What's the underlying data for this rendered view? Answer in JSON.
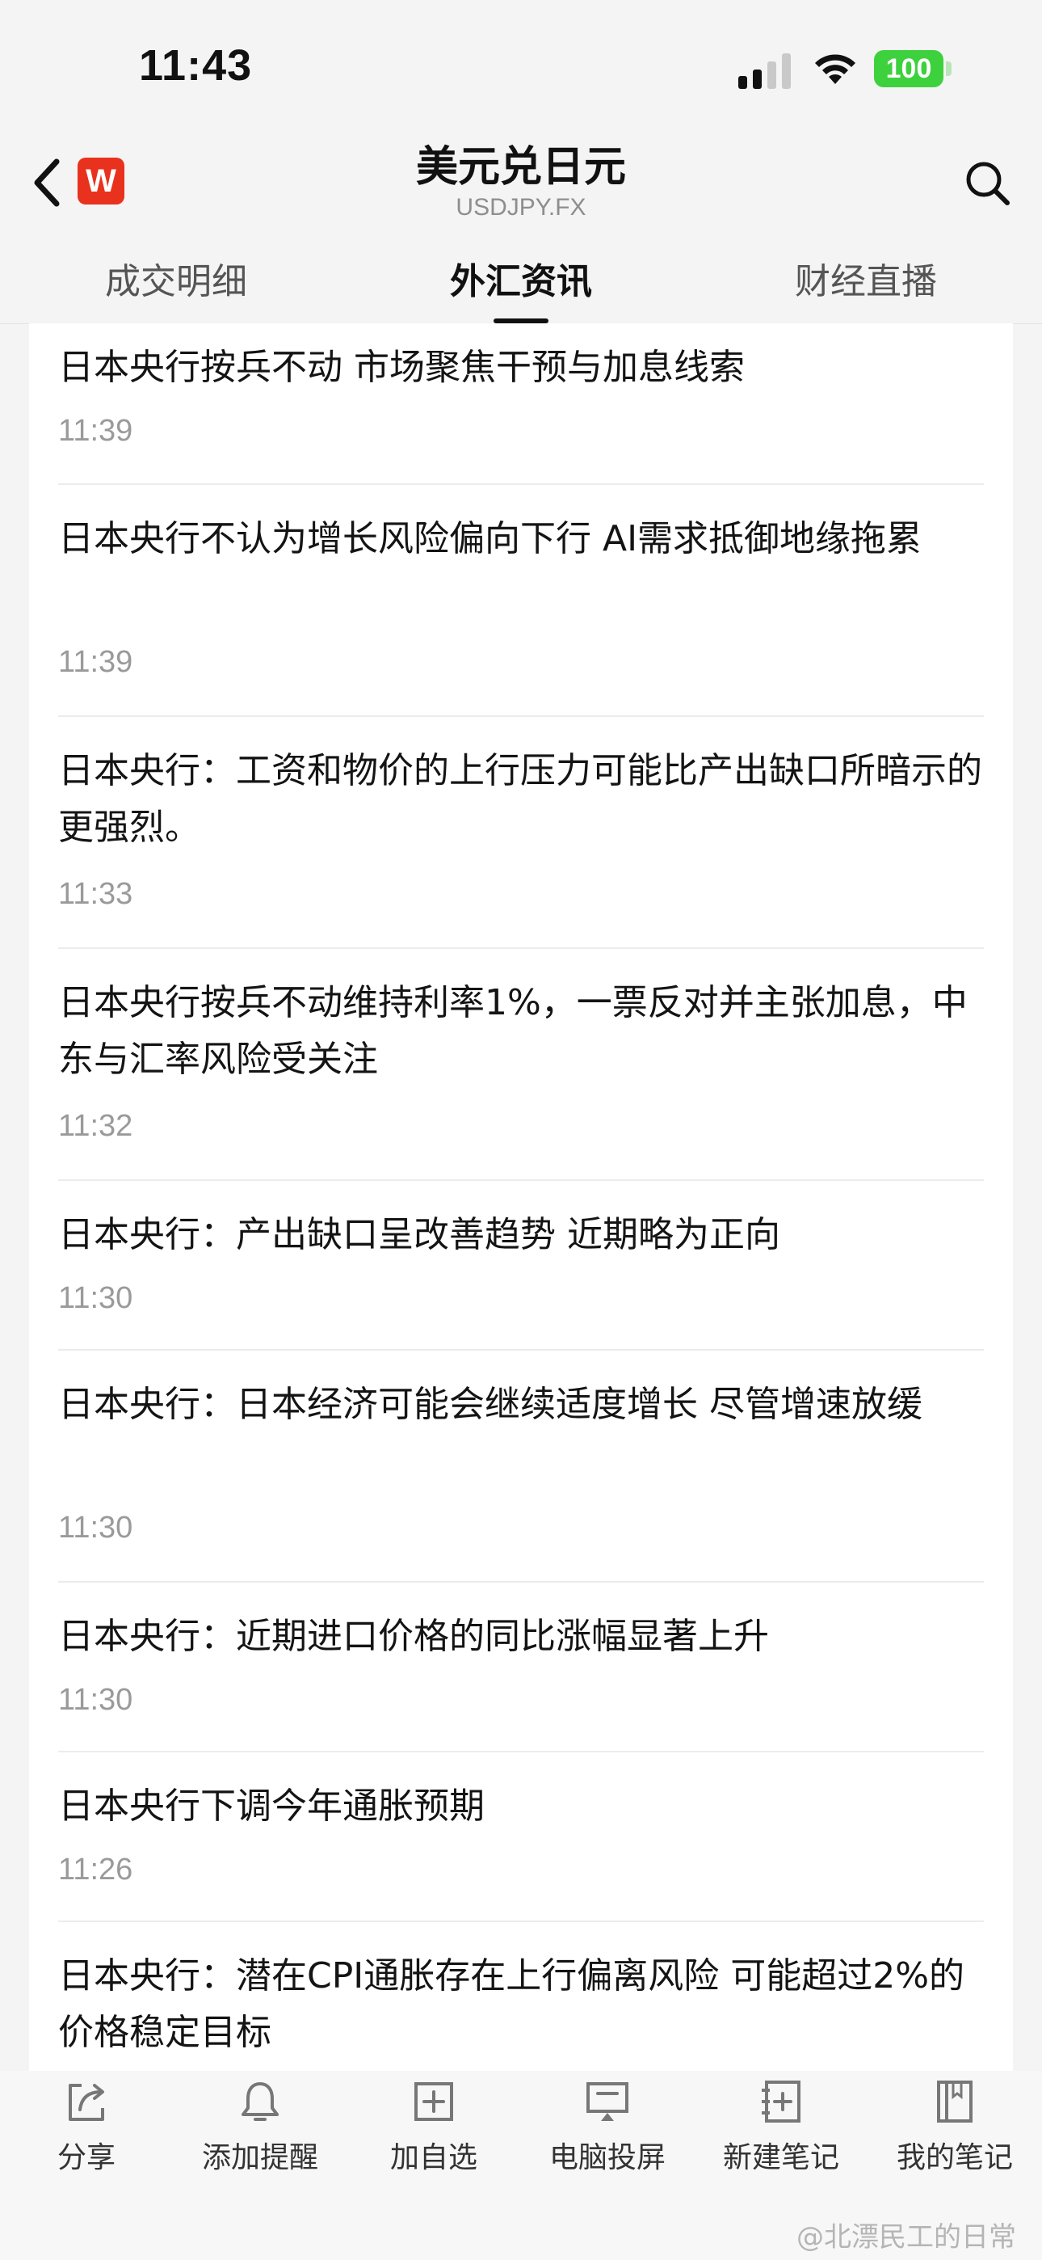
{
  "status_bar": {
    "time": "11:43",
    "battery": "100"
  },
  "header": {
    "title": "美元兑日元",
    "subtitle": "USDJPY.FX",
    "logo_letter": "W"
  },
  "tabs": [
    {
      "label": "成交明细"
    },
    {
      "label": "外汇资讯"
    },
    {
      "label": "财经直播"
    }
  ],
  "news": [
    {
      "title": "日本央行按兵不动 市场聚焦干预与加息线索",
      "time": "11:39"
    },
    {
      "title": "日本央行不认为增长风险偏向下行 AI需求抵御地缘拖累",
      "time": "11:39"
    },
    {
      "title": "日本央行：工资和物价的上行压力可能比产出缺口所暗示的更强烈。",
      "time": "11:33"
    },
    {
      "title": "日本央行按兵不动维持利率1%，一票反对并主张加息，中东与汇率风险受关注",
      "time": "11:32"
    },
    {
      "title": "日本央行：产出缺口呈改善趋势 近期略为正向",
      "time": "11:30"
    },
    {
      "title": "日本央行：日本经济可能会继续适度增长 尽管增速放缓",
      "time": "11:30"
    },
    {
      "title": "日本央行：近期进口价格的同比涨幅显著上升",
      "time": "11:30"
    },
    {
      "title": "日本央行下调今年通胀预期",
      "time": "11:26"
    },
    {
      "title": "日本央行：潜在CPI通胀存在上行偏离风险 可能超过2%的价格稳定目标",
      "time": ""
    }
  ],
  "toolbar": [
    {
      "label": "分享",
      "icon": "share-icon"
    },
    {
      "label": "添加提醒",
      "icon": "bell-icon"
    },
    {
      "label": "加自选",
      "icon": "add-box-icon"
    },
    {
      "label": "电脑投屏",
      "icon": "screen-cast-icon"
    },
    {
      "label": "新建笔记",
      "icon": "new-note-icon"
    },
    {
      "label": "我的笔记",
      "icon": "notebook-icon"
    }
  ],
  "watermark": "@北漂民工的日常",
  "colors": {
    "background": "#f4f4f4",
    "card": "#ffffff",
    "battery": "#3dd13d",
    "logo": "#e8321e",
    "time_text": "#9a9a9a"
  }
}
